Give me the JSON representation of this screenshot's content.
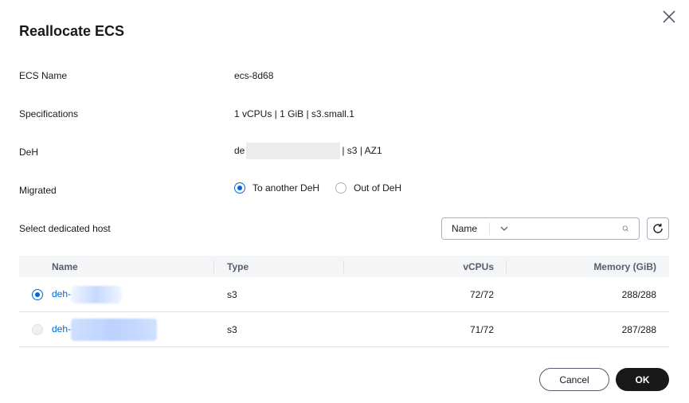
{
  "dialog": {
    "title": "Reallocate ECS",
    "fields": {
      "ecs_name_label": "ECS Name",
      "ecs_name_value": "ecs-8d68",
      "spec_label": "Specifications",
      "spec_value": "1 vCPUs | 1 GiB | s3.small.1",
      "deh_label": "DeH",
      "deh_value_prefix": "de",
      "deh_value_suffix": "| s3 | AZ1",
      "migrated_label": "Migrated",
      "migrated_options": [
        "To another DeH",
        "Out of DeH"
      ],
      "migrated_selected": "To another DeH",
      "select_host_label": "Select dedicated host"
    },
    "search": {
      "filter_value": "Name",
      "input_value": "",
      "input_placeholder": ""
    },
    "table": {
      "headers": {
        "name": "Name",
        "type": "Type",
        "vcpus": "vCPUs",
        "memory": "Memory (GiB)"
      },
      "rows": [
        {
          "name": "deh-",
          "type": "s3",
          "vcpus": "72/72",
          "memory": "288/288",
          "selected": true
        },
        {
          "name": "deh-",
          "type": "s3",
          "vcpus": "71/72",
          "memory": "287/288",
          "selected": false
        }
      ]
    },
    "buttons": {
      "cancel": "Cancel",
      "ok": "OK"
    },
    "icons": {
      "close": "close-icon",
      "search": "search-icon",
      "refresh": "refresh-icon",
      "chevron": "chevron-down-icon"
    },
    "colors": {
      "accent": "#0066dd",
      "primary_button": "#191919",
      "header_bg": "#f4f5f7"
    }
  }
}
